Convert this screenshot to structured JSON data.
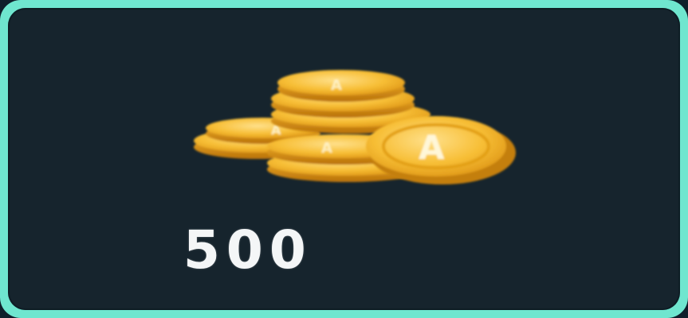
{
  "reward": {
    "amount": "500",
    "icon": "coin-stack-icon",
    "coin_mark": "A"
  },
  "colors": {
    "border": "#6fe6cf",
    "background": "#16242d",
    "coin_gold": "#f5b82a",
    "text": "#f4f6f7"
  }
}
